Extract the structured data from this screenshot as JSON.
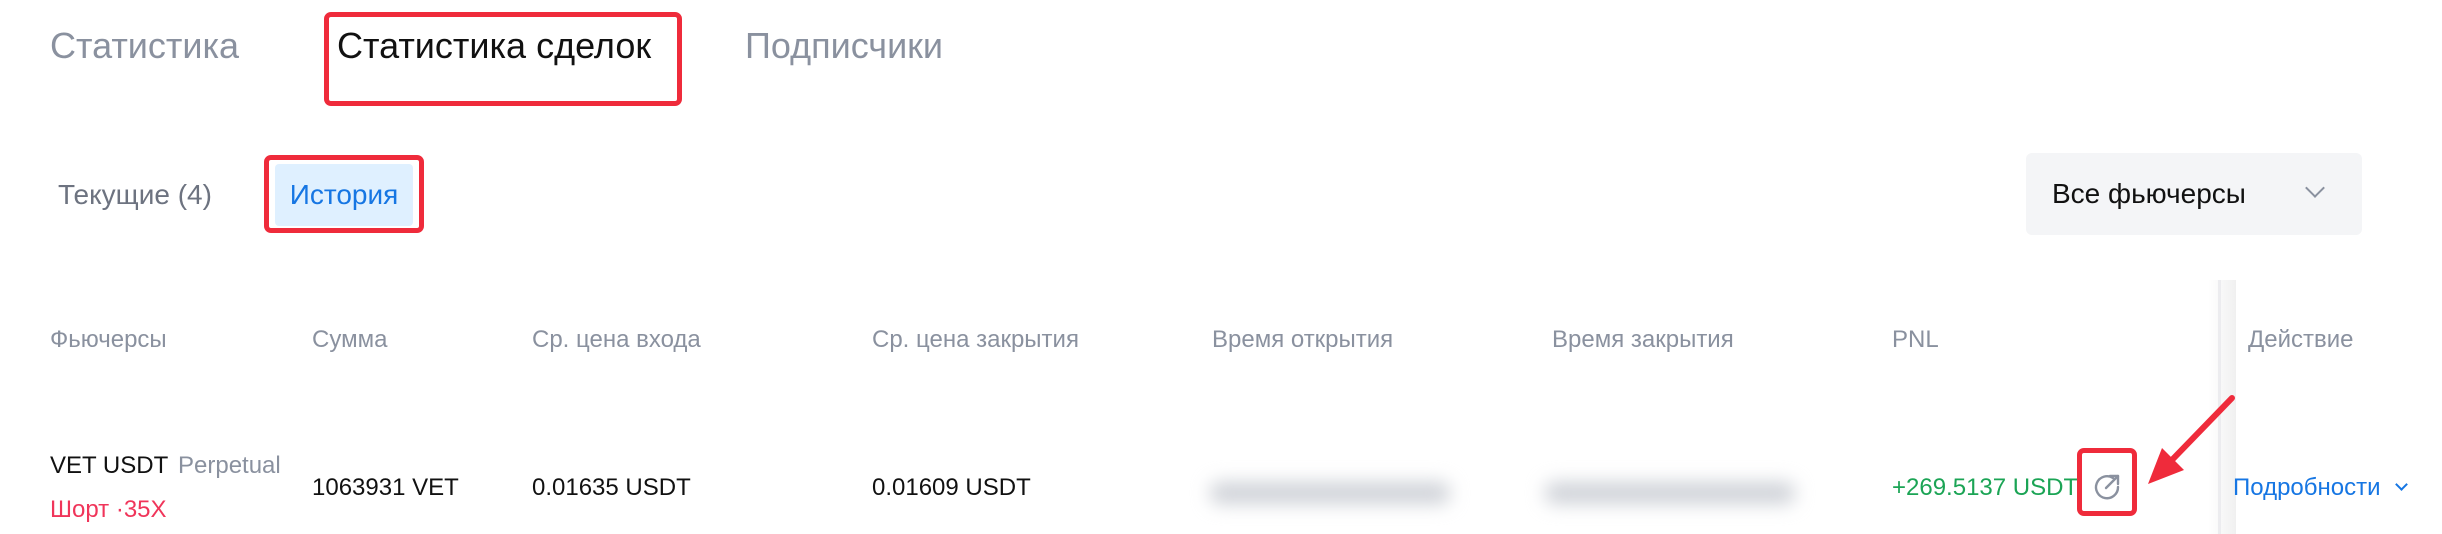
{
  "tabs": {
    "statistics": "Статистика",
    "trade_statistics": "Статистика сделок",
    "subscribers": "Подписчики"
  },
  "subtabs": {
    "current": "Текущие (4)",
    "history": "История"
  },
  "filter": {
    "selected": "Все фьючерсы"
  },
  "table": {
    "headers": {
      "futures": "Фьючерсы",
      "amount": "Сумма",
      "entry_price": "Ср. цена входа",
      "close_price": "Ср. цена закрытия",
      "open_time": "Время открытия",
      "close_time": "Время закрытия",
      "pnl": "PNL",
      "action": "Действие"
    },
    "rows": [
      {
        "symbol": "VET USDT",
        "contract": "Perpetual",
        "side": "Шорт ·35X",
        "amount": "1063931 VET",
        "entry_price": "0.01635 USDT",
        "close_price": "0.01609 USDT",
        "pnl": "+269.5137 USDT",
        "details": "Подробности"
      }
    ]
  },
  "colors": {
    "accent": "#1676e3",
    "highlight": "#ef2b3b",
    "profit": "#1ba455",
    "short": "#f0355a"
  }
}
